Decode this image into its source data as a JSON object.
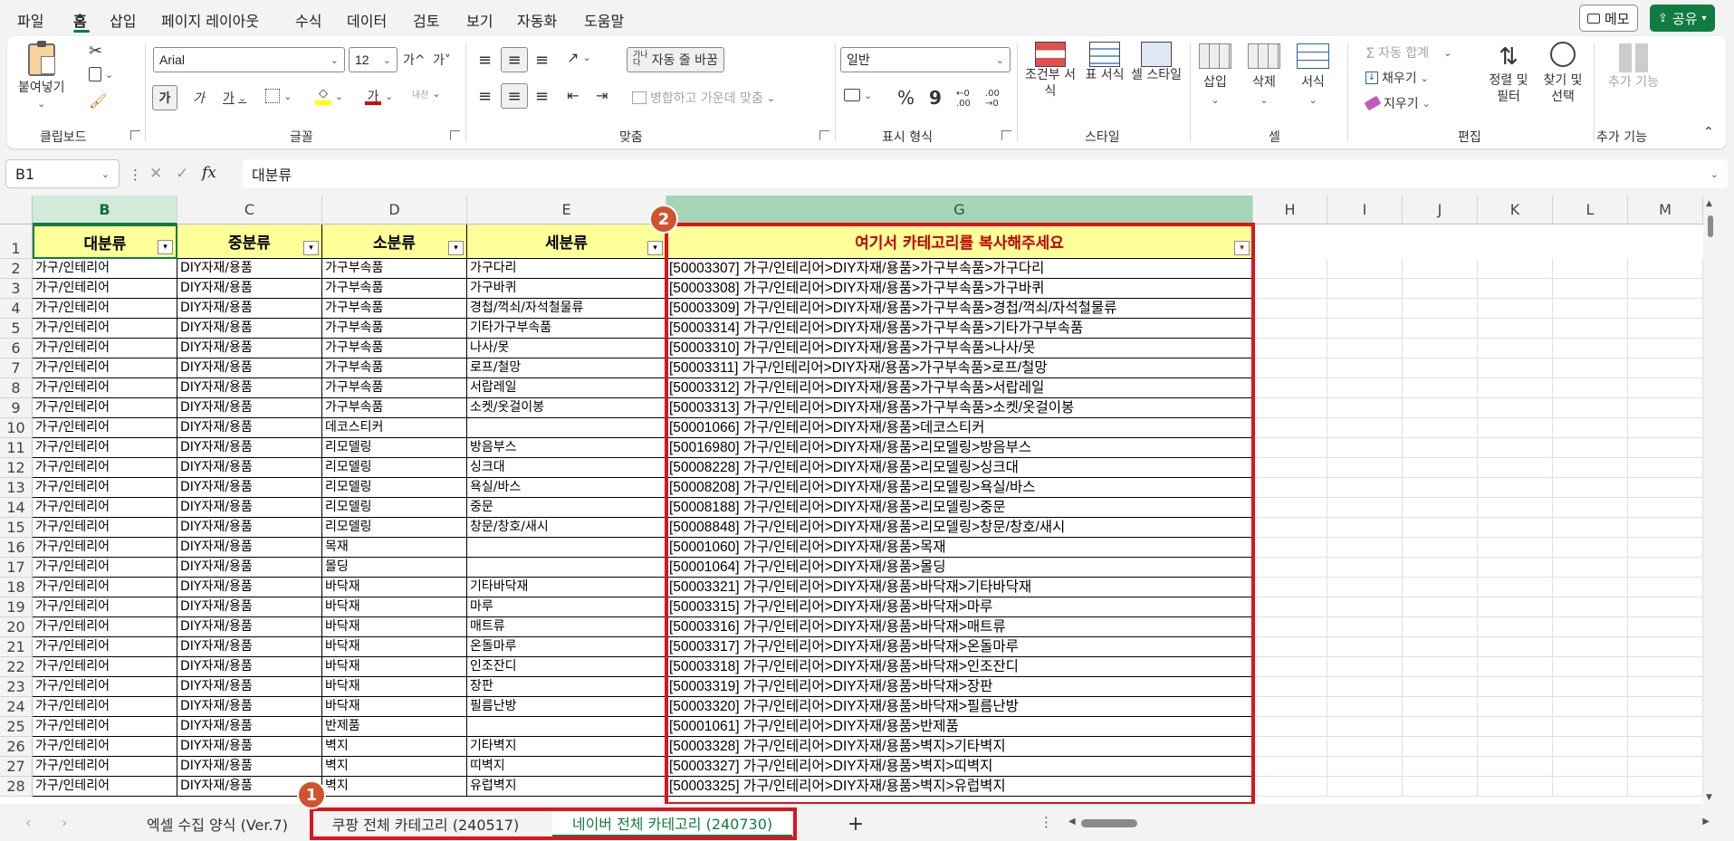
{
  "menu": {
    "items": [
      "파일",
      "홈",
      "삽입",
      "페이지 레이아웃",
      "수식",
      "데이터",
      "검토",
      "보기",
      "자동화",
      "도움말"
    ],
    "active": "홈",
    "memo_label": "메모",
    "share_label": "공유"
  },
  "ribbon": {
    "clipboard": {
      "paste_label": "붙여넣기",
      "group_label": "클립보드"
    },
    "font": {
      "name": "Arial",
      "size": "12",
      "bold": "가",
      "italic": "가",
      "underline": "가",
      "grow": "가^",
      "shrink": "가˅",
      "group_label": "글꼴"
    },
    "align": {
      "wrap_label": "자동 줄 바꿈",
      "merge_label": "병합하고 가운데 맞춤",
      "group_label": "맞춤"
    },
    "number": {
      "format": "일반",
      "percent": "%",
      "comma": "9",
      "group_label": "표시 형식"
    },
    "styles": {
      "cond_label": "조건부 서식",
      "table_label": "표 서식",
      "cell_label": "셀 스타일",
      "group_label": "스타일"
    },
    "cells": {
      "insert_label": "삽입",
      "delete_label": "삭제",
      "format_label": "서식",
      "group_label": "셀"
    },
    "editing": {
      "autosum_label": "자동 합계",
      "fill_label": "채우기",
      "clear_label": "지우기",
      "sort_label": "정렬 및 필터",
      "find_label": "찾기 및 선택",
      "group_label": "편집"
    },
    "addins": {
      "label": "추가 기능",
      "group_label": "추가 기능"
    }
  },
  "formula_bar": {
    "name_box": "B1",
    "fx": "fx",
    "value": "대분류"
  },
  "columns": [
    "B",
    "C",
    "D",
    "E",
    "G",
    "H",
    "I",
    "J",
    "K",
    "L",
    "M"
  ],
  "headers": {
    "b": "대분류",
    "c": "중분류",
    "d": "소분류",
    "e": "세분류",
    "g": "여기서 카테고리를 복사해주세요"
  },
  "rows": [
    {
      "n": "2",
      "b": "가구/인테리어",
      "c": "DIY자재/용품",
      "d": "가구부속품",
      "e": "가구다리",
      "g": "[50003307] 가구/인테리어>DIY자재/용품>가구부속품>가구다리"
    },
    {
      "n": "3",
      "b": "가구/인테리어",
      "c": "DIY자재/용품",
      "d": "가구부속품",
      "e": "가구바퀴",
      "g": "[50003308] 가구/인테리어>DIY자재/용품>가구부속품>가구바퀴"
    },
    {
      "n": "4",
      "b": "가구/인테리어",
      "c": "DIY자재/용품",
      "d": "가구부속품",
      "e": "경첩/꺽쇠/자석철물류",
      "g": "[50003309] 가구/인테리어>DIY자재/용품>가구부속품>경첩/꺽쇠/자석철물류"
    },
    {
      "n": "5",
      "b": "가구/인테리어",
      "c": "DIY자재/용품",
      "d": "가구부속품",
      "e": "기타가구부속품",
      "g": "[50003314] 가구/인테리어>DIY자재/용품>가구부속품>기타가구부속품"
    },
    {
      "n": "6",
      "b": "가구/인테리어",
      "c": "DIY자재/용품",
      "d": "가구부속품",
      "e": "나사/못",
      "g": "[50003310] 가구/인테리어>DIY자재/용품>가구부속품>나사/못"
    },
    {
      "n": "7",
      "b": "가구/인테리어",
      "c": "DIY자재/용품",
      "d": "가구부속품",
      "e": "로프/철망",
      "g": "[50003311] 가구/인테리어>DIY자재/용품>가구부속품>로프/철망"
    },
    {
      "n": "8",
      "b": "가구/인테리어",
      "c": "DIY자재/용품",
      "d": "가구부속품",
      "e": "서랍레일",
      "g": "[50003312] 가구/인테리어>DIY자재/용품>가구부속품>서랍레일"
    },
    {
      "n": "9",
      "b": "가구/인테리어",
      "c": "DIY자재/용품",
      "d": "가구부속품",
      "e": "소켓/옷걸이봉",
      "g": "[50003313] 가구/인테리어>DIY자재/용품>가구부속품>소켓/옷걸이봉"
    },
    {
      "n": "10",
      "b": "가구/인테리어",
      "c": "DIY자재/용품",
      "d": "데코스티커",
      "e": "",
      "g": "[50001066] 가구/인테리어>DIY자재/용품>데코스티커"
    },
    {
      "n": "11",
      "b": "가구/인테리어",
      "c": "DIY자재/용품",
      "d": "리모델링",
      "e": "방음부스",
      "g": "[50016980] 가구/인테리어>DIY자재/용품>리모델링>방음부스"
    },
    {
      "n": "12",
      "b": "가구/인테리어",
      "c": "DIY자재/용품",
      "d": "리모델링",
      "e": "싱크대",
      "g": "[50008228] 가구/인테리어>DIY자재/용품>리모델링>싱크대"
    },
    {
      "n": "13",
      "b": "가구/인테리어",
      "c": "DIY자재/용품",
      "d": "리모델링",
      "e": "욕실/바스",
      "g": "[50008208] 가구/인테리어>DIY자재/용품>리모델링>욕실/바스"
    },
    {
      "n": "14",
      "b": "가구/인테리어",
      "c": "DIY자재/용품",
      "d": "리모델링",
      "e": "중문",
      "g": "[50008188] 가구/인테리어>DIY자재/용품>리모델링>중문"
    },
    {
      "n": "15",
      "b": "가구/인테리어",
      "c": "DIY자재/용품",
      "d": "리모델링",
      "e": "창문/창호/새시",
      "g": "[50008848] 가구/인테리어>DIY자재/용품>리모델링>창문/창호/새시"
    },
    {
      "n": "16",
      "b": "가구/인테리어",
      "c": "DIY자재/용품",
      "d": "목재",
      "e": "",
      "g": "[50001060] 가구/인테리어>DIY자재/용품>목재"
    },
    {
      "n": "17",
      "b": "가구/인테리어",
      "c": "DIY자재/용품",
      "d": "몰딩",
      "e": "",
      "g": "[50001064] 가구/인테리어>DIY자재/용품>몰딩"
    },
    {
      "n": "18",
      "b": "가구/인테리어",
      "c": "DIY자재/용품",
      "d": "바닥재",
      "e": "기타바닥재",
      "g": "[50003321] 가구/인테리어>DIY자재/용품>바닥재>기타바닥재"
    },
    {
      "n": "19",
      "b": "가구/인테리어",
      "c": "DIY자재/용품",
      "d": "바닥재",
      "e": "마루",
      "g": "[50003315] 가구/인테리어>DIY자재/용품>바닥재>마루"
    },
    {
      "n": "20",
      "b": "가구/인테리어",
      "c": "DIY자재/용품",
      "d": "바닥재",
      "e": "매트류",
      "g": "[50003316] 가구/인테리어>DIY자재/용품>바닥재>매트류"
    },
    {
      "n": "21",
      "b": "가구/인테리어",
      "c": "DIY자재/용품",
      "d": "바닥재",
      "e": "온돌마루",
      "g": "[50003317] 가구/인테리어>DIY자재/용품>바닥재>온돌마루"
    },
    {
      "n": "22",
      "b": "가구/인테리어",
      "c": "DIY자재/용품",
      "d": "바닥재",
      "e": "인조잔디",
      "g": "[50003318] 가구/인테리어>DIY자재/용품>바닥재>인조잔디"
    },
    {
      "n": "23",
      "b": "가구/인테리어",
      "c": "DIY자재/용품",
      "d": "바닥재",
      "e": "장판",
      "g": "[50003319] 가구/인테리어>DIY자재/용품>바닥재>장판"
    },
    {
      "n": "24",
      "b": "가구/인테리어",
      "c": "DIY자재/용품",
      "d": "바닥재",
      "e": "필름난방",
      "g": "[50003320] 가구/인테리어>DIY자재/용품>바닥재>필름난방"
    },
    {
      "n": "25",
      "b": "가구/인테리어",
      "c": "DIY자재/용품",
      "d": "반제품",
      "e": "",
      "g": "[50001061] 가구/인테리어>DIY자재/용품>반제품"
    },
    {
      "n": "26",
      "b": "가구/인테리어",
      "c": "DIY자재/용품",
      "d": "벽지",
      "e": "기타벽지",
      "g": "[50003328] 가구/인테리어>DIY자재/용품>벽지>기타벽지"
    },
    {
      "n": "27",
      "b": "가구/인테리어",
      "c": "DIY자재/용품",
      "d": "벽지",
      "e": "띠벽지",
      "g": "[50003327] 가구/인테리어>DIY자재/용품>벽지>띠벽지"
    },
    {
      "n": "28",
      "b": "가구/인테리어",
      "c": "DIY자재/용품",
      "d": "벽지",
      "e": "유럽벽지",
      "g": "[50003325] 가구/인테리어>DIY자재/용품>벽지>유럽벽지"
    }
  ],
  "tabs": {
    "t1": "엑셀 수집 양식 (Ver.7)",
    "t2": "쿠팡 전체 카테고리 (240517)",
    "t3": "네이버 전체 카테고리 (240730)",
    "add": "+"
  },
  "badges": {
    "one": "1",
    "two": "2"
  },
  "colors": {
    "accent": "#107c41",
    "header_fill": "#ffff99",
    "callout": "#e0121e",
    "badge": "#d0532e",
    "g_header_text": "#c00000"
  }
}
